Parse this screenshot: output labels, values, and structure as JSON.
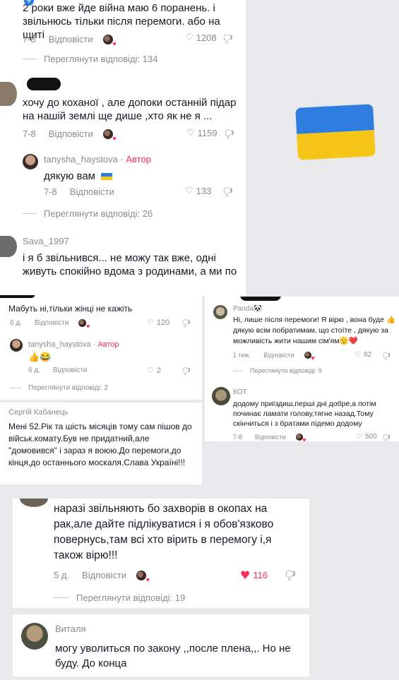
{
  "panel1": {
    "comment1": {
      "text": "2 роки вже йде війна маю 6 поранень. і звільнюсь тільки після перемоги. або на щиті",
      "date": "7-8",
      "reply": "Відповісти",
      "likes": "1208",
      "view_replies": "Переглянути відповіді: 134"
    },
    "comment2": {
      "text": "хочу до коханої , але допоки останній підар на нашій землі ще дише ,хто як не я ...",
      "date": "7-8",
      "reply": "Відповісти",
      "likes": "1159"
    },
    "reply1": {
      "username": "tanysha_haystova",
      "author_badge": "· Автор",
      "text": "дякую вам",
      "date": "7-8",
      "reply": "Відповісти",
      "likes": "133"
    },
    "view_replies_2": "Переглянути відповіді: 26",
    "comment3": {
      "username": "Sava_1997",
      "text": "і я б звільнився... не можу так вже, одні живуть спокійно вдома з родинами, а ми по"
    }
  },
  "panel2": {
    "comment1": {
      "text": "Мабуть ні,тільки жінці не кажіть",
      "date": "6 д.",
      "reply": "Відповісти",
      "likes": "120"
    },
    "reply1": {
      "username": "tanysha_haystova",
      "author_badge": "· Автор",
      "text": "👍😂",
      "date": "6 д.",
      "reply": "Відповісти",
      "likes": "2"
    },
    "view_replies": "Переглянути відповіді: 2"
  },
  "panel3": {
    "comment1": {
      "username": "Panda🐼",
      "text": "Ні, лише після перемоги! Я вірю , вона буде 👍дякую всім побратимам, що стоїте , дякую за можливість жити нашим сім'ям🫡❤️",
      "date": "1 тиж.",
      "reply": "Відповісти",
      "likes": "82",
      "view_replies": "Переглянути відповіді: 9"
    },
    "comment2": {
      "username": "КОТ",
      "text": "додому приїздиш,перші дні добре,а потім починає ламати голову,тягне назад.Тому скінчиться і з братами підемо додому",
      "date": "7-8",
      "reply": "Відповісти",
      "likes": "500"
    }
  },
  "panel4": {
    "comment1": {
      "username": "Сергій Кабанець",
      "text": "Мені 52.Рік та шість місяців тому сам пішов до військ.комату.Був не придатний,але \"домовився\" і зараз я воюю.До перемоги,до кінця,до останнього москаля.Слава Україні!!!"
    }
  },
  "panel5": {
    "comment1": {
      "text": "наразі звільняють бо захворів в окопах на рак,але дайте підлікуватися і я обов'язково повернусь,там всі хто вірить в перемогу і,я також вірю!!!",
      "date": "5 д.",
      "reply": "Відповісти",
      "likes": "116",
      "view_replies": "Переглянути відповіді: 19"
    },
    "comment2": {
      "username": "Виталя",
      "text": "могу уволиться по закону ,,после плена,,. Но не буду. До конца"
    }
  },
  "colors": {
    "like_active": "#fe2c55",
    "flag_blue": "#2f7de1",
    "flag_yellow": "#f5c518"
  },
  "icons": [
    "heart-icon",
    "dislike-icon",
    "ukraine-flag-icon",
    "avatar"
  ]
}
